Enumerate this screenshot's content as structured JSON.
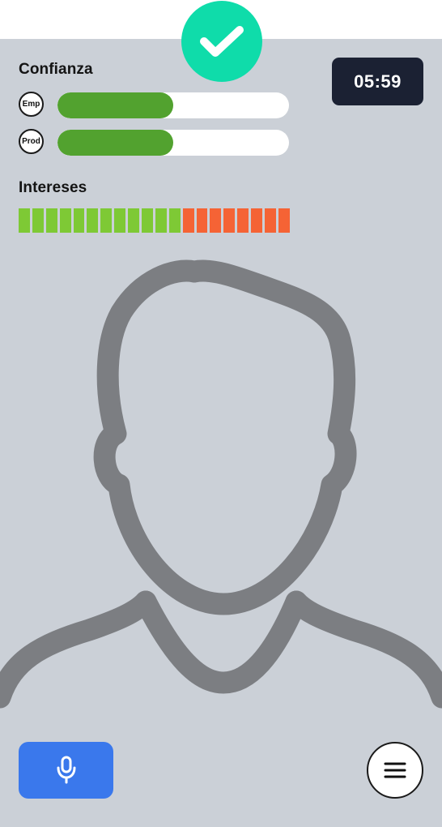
{
  "status": {
    "icon": "check-icon",
    "color": "#0fdcaa"
  },
  "confianza": {
    "title": "Confianza",
    "metrics": [
      {
        "badge": "Emp",
        "level": 0.5,
        "color": "#52a22f"
      },
      {
        "badge": "Prod",
        "level": 0.5,
        "color": "#52a22f"
      }
    ]
  },
  "intereses": {
    "title": "Intereses",
    "segments_total": 20,
    "segments_filled": 12,
    "filled_color": "#7ec935",
    "empty_color": "#f56335"
  },
  "timer": {
    "value": "05:59"
  },
  "avatar": {
    "icon": "person-silhouette-icon"
  },
  "controls": {
    "mic_icon": "microphone-icon",
    "mic_color": "#3a78ec",
    "menu_icon": "hamburger-menu-icon"
  }
}
